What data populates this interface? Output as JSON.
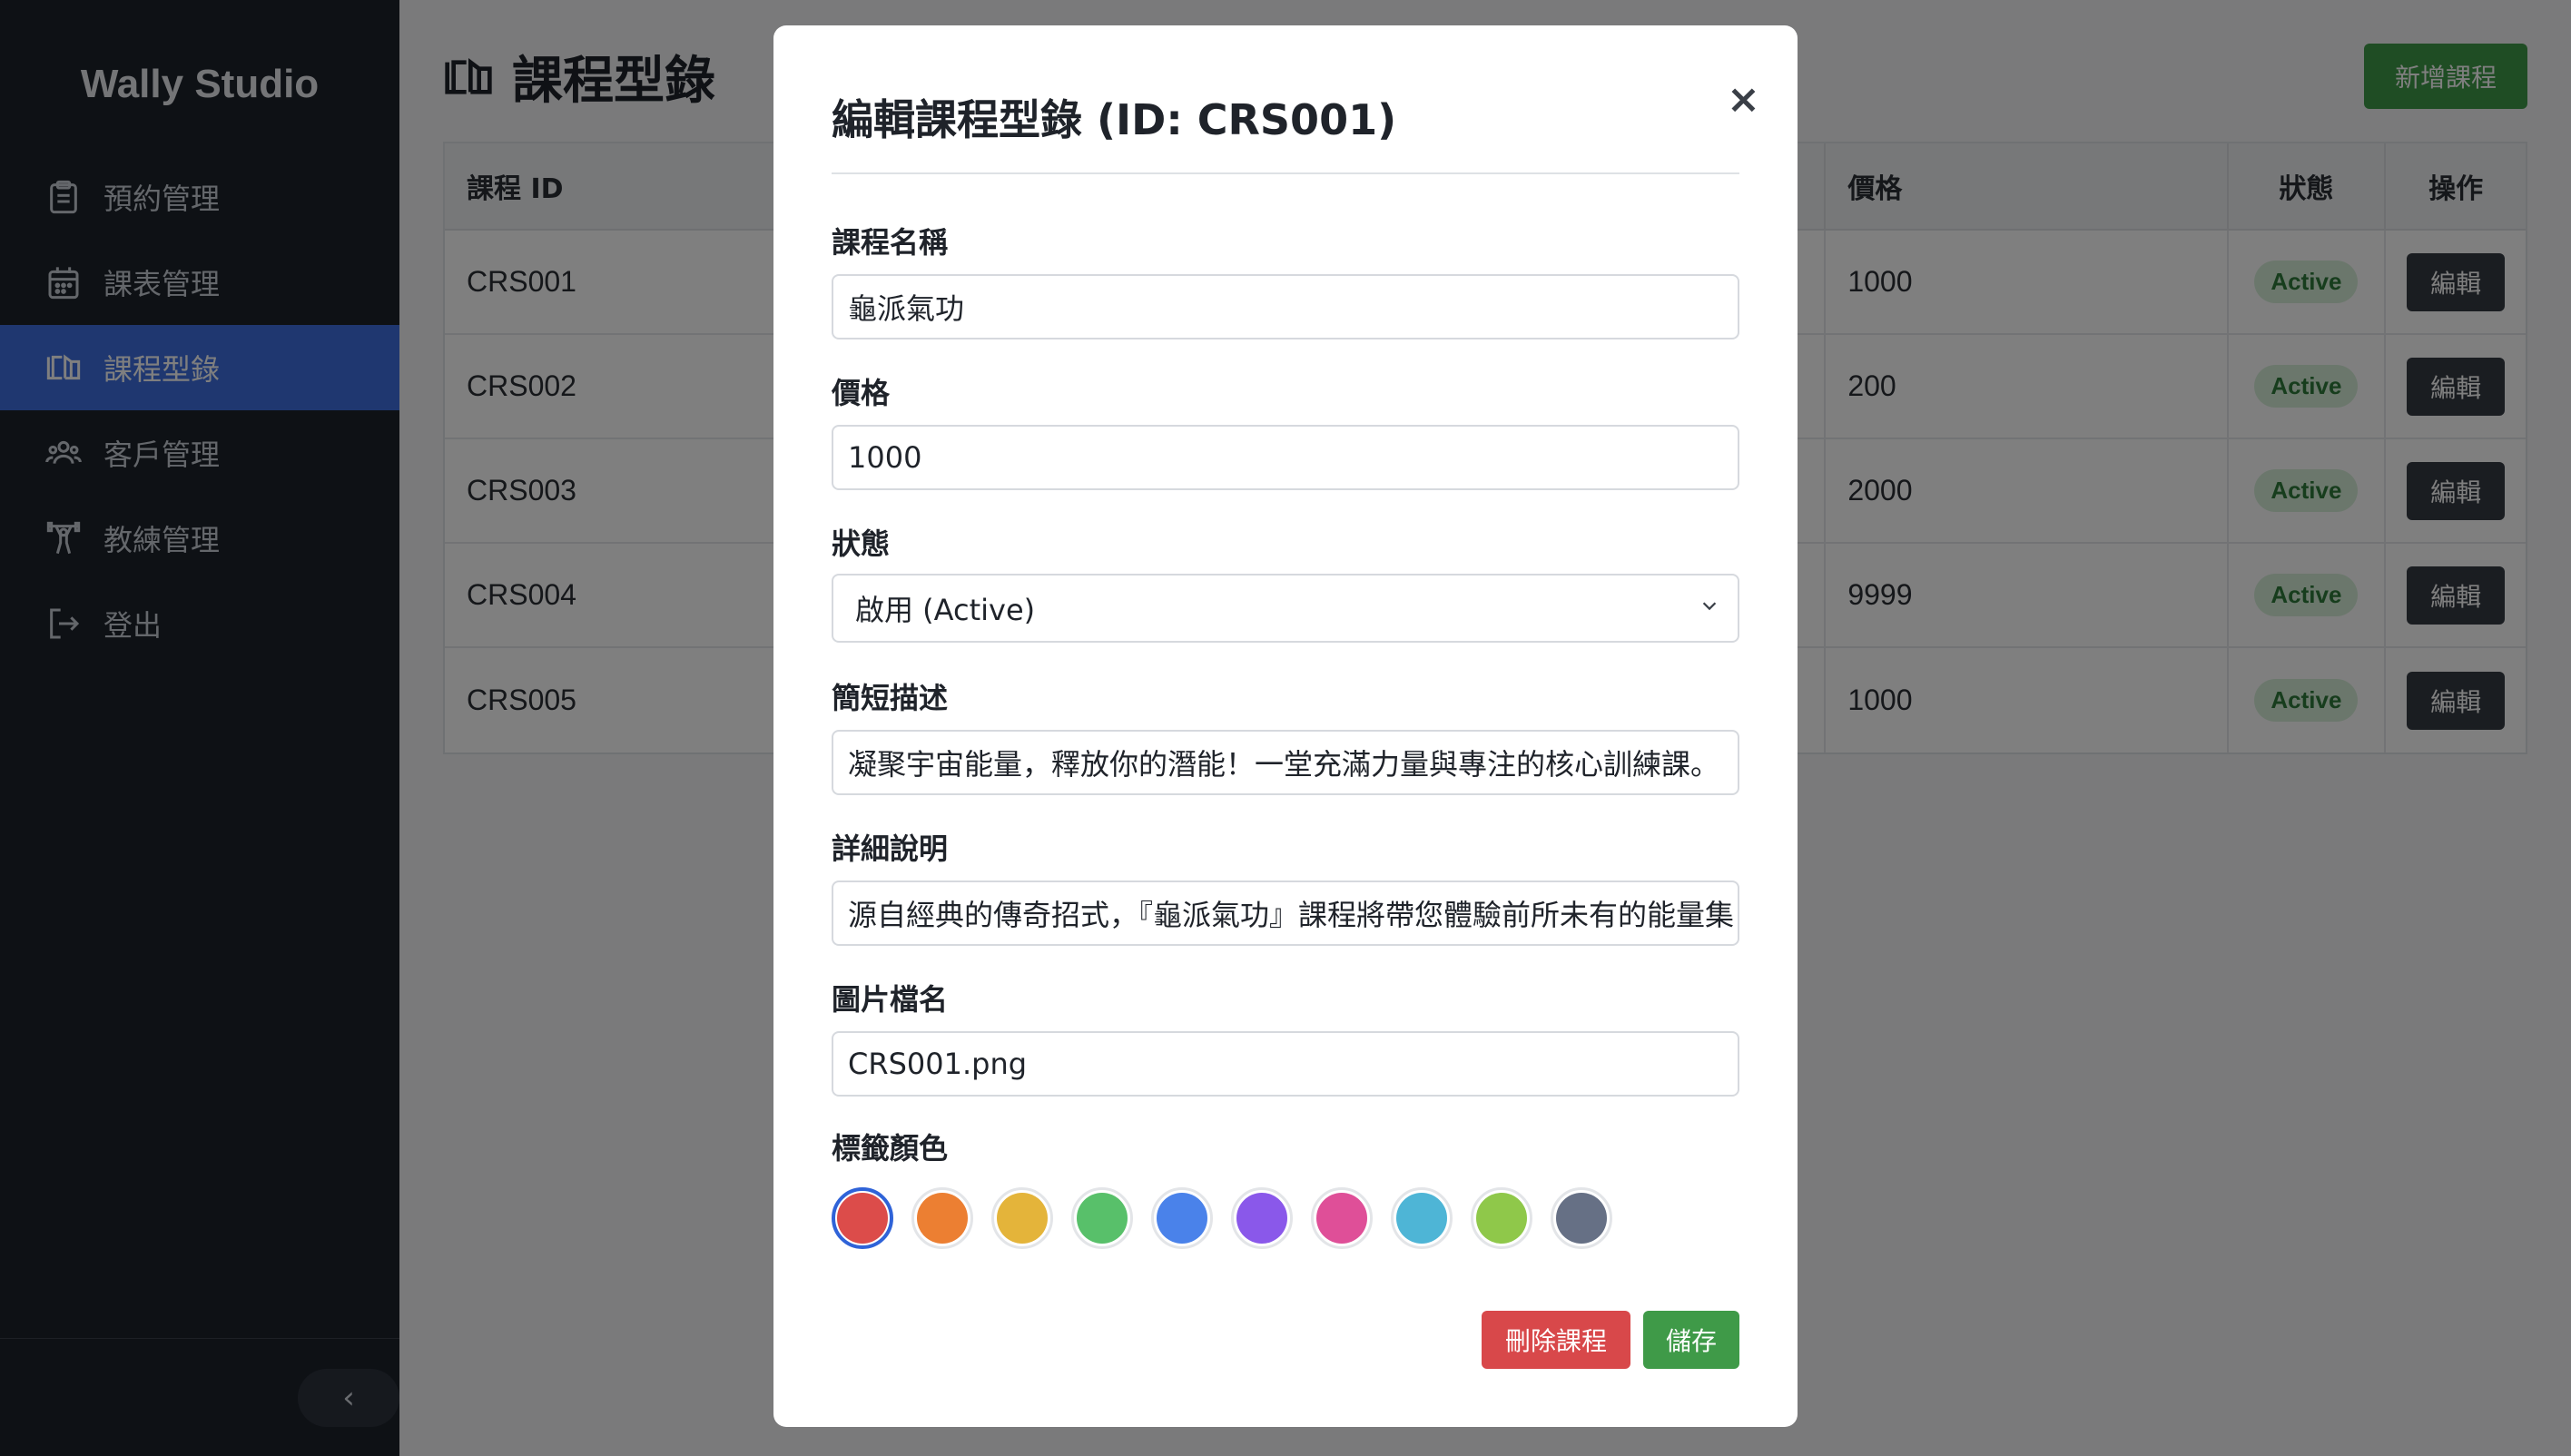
{
  "app": {
    "brand": "Wally Studio"
  },
  "sidebar": {
    "items": [
      {
        "label": "預約管理",
        "icon": "clipboard-icon",
        "active": false
      },
      {
        "label": "課表管理",
        "icon": "calendar-icon",
        "active": false
      },
      {
        "label": "課程型錄",
        "icon": "book-icon",
        "active": true
      },
      {
        "label": "客戶管理",
        "icon": "users-icon",
        "active": false
      },
      {
        "label": "教練管理",
        "icon": "weightlifter-icon",
        "active": false
      },
      {
        "label": "登出",
        "icon": "logout-icon",
        "active": false
      }
    ],
    "collapse_glyph": "‹"
  },
  "main": {
    "title": "課程型錄",
    "add_button": "新增課程",
    "table": {
      "headers": {
        "id": "課程 ID",
        "price": "價格",
        "status": "狀態",
        "action": "操作"
      },
      "rows": [
        {
          "id": "CRS001",
          "price": "1000",
          "status": "Active",
          "action": "編輯"
        },
        {
          "id": "CRS002",
          "price": "200",
          "status": "Active",
          "action": "編輯"
        },
        {
          "id": "CRS003",
          "price": "2000",
          "status": "Active",
          "action": "編輯"
        },
        {
          "id": "CRS004",
          "price": "9999",
          "status": "Active",
          "action": "編輯"
        },
        {
          "id": "CRS005",
          "price": "1000",
          "status": "Active",
          "action": "編輯"
        }
      ]
    }
  },
  "modal": {
    "title": "編輯課程型錄 (ID: CRS001)",
    "close": "×",
    "fields": {
      "name": {
        "label": "課程名稱",
        "value": "龜派氣功"
      },
      "price": {
        "label": "價格",
        "value": "1000"
      },
      "status": {
        "label": "狀態",
        "value": "啟用 (Active)"
      },
      "short_desc": {
        "label": "簡短描述",
        "value": "凝聚宇宙能量，釋放你的潛能！一堂充滿力量與專注的核心訓練課。"
      },
      "detail": {
        "label": "詳細說明",
        "value": "源自經典的傳奇招式，『龜派氣功』課程將帶您體驗前所未有的能量集"
      },
      "image": {
        "label": "圖片檔名",
        "value": "CRS001.png"
      }
    },
    "color_label": "標籤顏色",
    "colors": [
      "#dc4c4a",
      "#ec7f32",
      "#e4b43a",
      "#58c06a",
      "#4a82ea",
      "#8a58ea",
      "#df4f98",
      "#4eb5d6",
      "#8fc84a",
      "#667085"
    ],
    "selected_color": "#dc4c4a",
    "delete_button": "刪除課程",
    "save_button": "儲存"
  }
}
